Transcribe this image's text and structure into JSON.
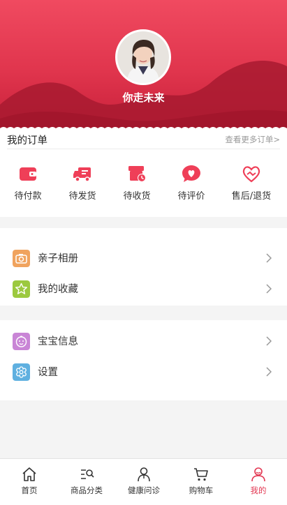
{
  "profile": {
    "username": "你走未来"
  },
  "orders": {
    "title": "我的订单",
    "more_label": "查看更多订单>",
    "items": [
      {
        "label": "待付款",
        "icon": "wallet-icon"
      },
      {
        "label": "待发货",
        "icon": "truck-icon"
      },
      {
        "label": "待收货",
        "icon": "package-clock-icon"
      },
      {
        "label": "待评价",
        "icon": "heart-bubble-icon"
      },
      {
        "label": "售后/退货",
        "icon": "handshake-heart-icon"
      }
    ]
  },
  "menu": {
    "group1": [
      {
        "label": "亲子相册",
        "icon": "camera-icon",
        "color": "#f0a35e"
      },
      {
        "label": "我的收藏",
        "icon": "star-icon",
        "color": "#9cc93f"
      }
    ],
    "group2": [
      {
        "label": "宝宝信息",
        "icon": "baby-face-icon",
        "color": "#c985d6"
      },
      {
        "label": "设置",
        "icon": "settings-flower-icon",
        "color": "#5fb0e0"
      }
    ]
  },
  "tabbar": {
    "items": [
      {
        "label": "首页",
        "icon": "home-icon"
      },
      {
        "label": "商品分类",
        "icon": "category-search-icon"
      },
      {
        "label": "健康问诊",
        "icon": "doctor-icon"
      },
      {
        "label": "购物车",
        "icon": "cart-icon"
      },
      {
        "label": "我的",
        "icon": "user-icon",
        "active": true
      }
    ]
  },
  "colors": {
    "brand": "#e23550",
    "background": "#f4f4f4"
  }
}
